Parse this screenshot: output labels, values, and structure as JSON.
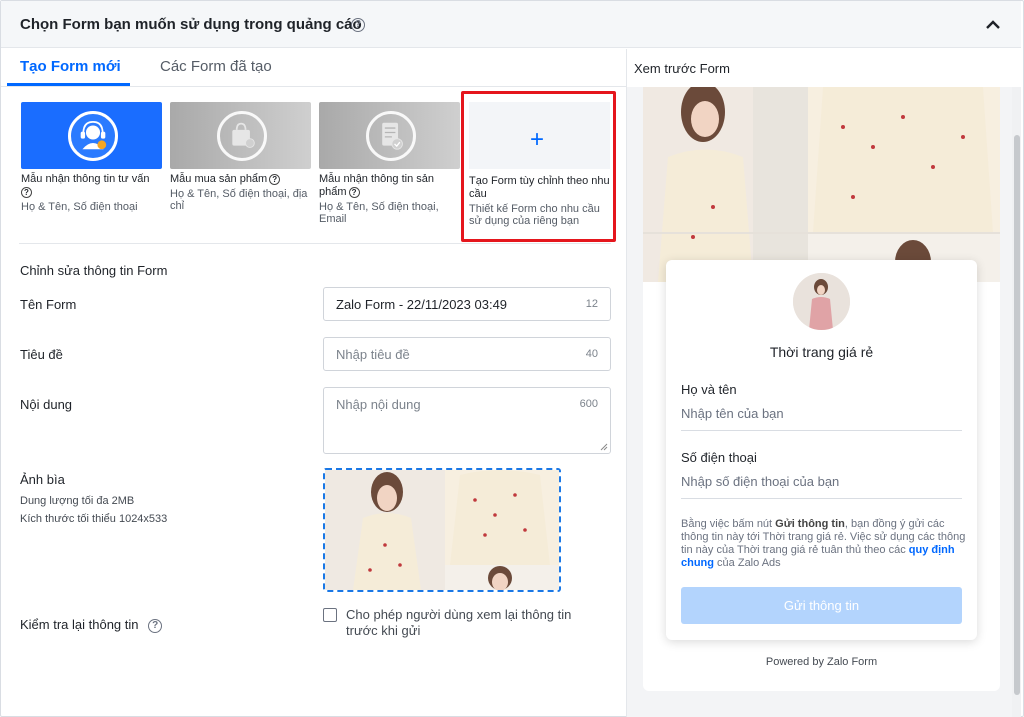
{
  "header": {
    "title": "Chọn Form bạn muốn sử dụng trong quảng cáo",
    "help_glyph": "?"
  },
  "tabs": [
    {
      "label": "Tạo Form mới",
      "active": true
    },
    {
      "label": "Các Form đã tạo",
      "active": false
    }
  ],
  "templates": [
    {
      "name": "Mẫu nhận thông tin tư vấn",
      "desc": "Họ & Tên, Số điện thoại",
      "icon": "support-agent-icon",
      "color": "#1a6dff"
    },
    {
      "name": "Mẫu mua sản phẩm",
      "desc": "Họ & Tên, Số điện thoại, địa chỉ",
      "icon": "shopping-bag-icon",
      "color": "#bdbdbd"
    },
    {
      "name": "Mẫu nhận thông tin sản phẩm",
      "desc": "Họ & Tên, Số điện thoại, Email",
      "icon": "document-check-icon",
      "color": "#bdbdbd"
    },
    {
      "name": "Tạo Form tùy chỉnh theo nhu cầu",
      "desc": "Thiết kế Form cho nhu cầu sử dụng của riêng bạn",
      "icon": "plus-icon",
      "color": "#0068ff"
    }
  ],
  "edit": {
    "section_title": "Chỉnh sửa thông tin Form",
    "form_name": {
      "label": "Tên Form",
      "value": "Zalo Form - 22/11/2023 03:49",
      "counter": "12"
    },
    "title": {
      "label": "Tiêu đề",
      "placeholder": "Nhập tiêu đề",
      "counter": "40"
    },
    "content": {
      "label": "Nội dung",
      "placeholder": "Nhập nội dung",
      "counter": "600"
    },
    "cover": {
      "label": "Ảnh bìa",
      "note1": "Dung lượng tối đa 2MB",
      "note2": "Kích thước tối thiểu 1024x533"
    },
    "review": {
      "label": "Kiểm tra lại thông tin",
      "checkbox_label": "Cho phép người dùng xem lại thông tin trước khi gửi",
      "checked": false
    }
  },
  "preview": {
    "title": "Xem trước Form",
    "brand": "Thời trang giá rẻ",
    "fields": [
      {
        "label": "Họ và tên",
        "placeholder": "Nhập tên của bạn"
      },
      {
        "label": "Số điện thoại",
        "placeholder": "Nhập số điện thoại của bạn"
      }
    ],
    "consent": {
      "part1": "Bằng việc bấm nút ",
      "bold": "Gửi thông tin",
      "part2": ", bạn đồng ý gửi các thông tin này tới Thời trang giá rẻ. Việc sử dụng các thông tin này của Thời trang giá rẻ tuân thủ theo các ",
      "link": "quy định chung",
      "part3": " của Zalo Ads"
    },
    "submit_label": "Gửi thông tin",
    "powered_by": "Powered by Zalo Form"
  },
  "colors": {
    "accent": "#0068ff",
    "highlight": "#e5161d",
    "submit_disabled": "#b3d4fd"
  }
}
